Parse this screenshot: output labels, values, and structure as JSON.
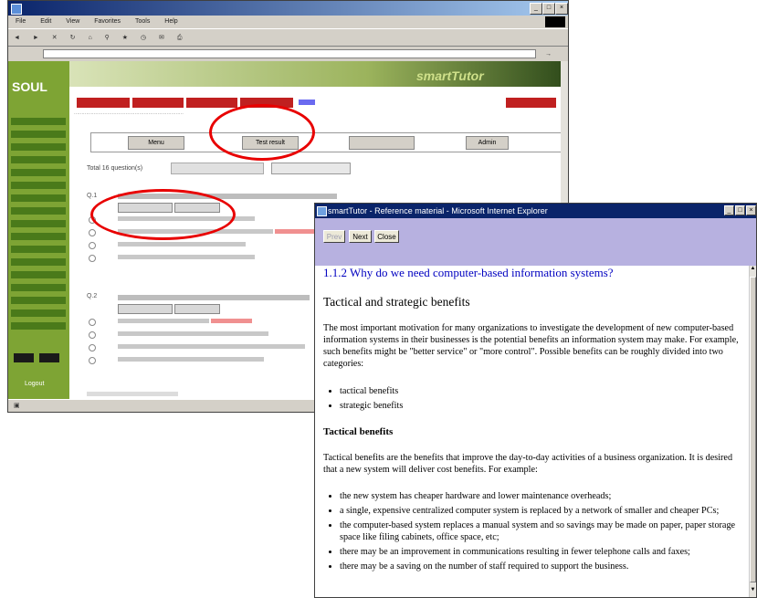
{
  "back_window": {
    "menu": [
      "File",
      "Edit",
      "View",
      "Favorites",
      "Tools",
      "Help"
    ],
    "logo": "SOUL",
    "banner_text": "smartTutor",
    "nav_buttons": [
      "Menu",
      "Test result",
      "",
      "Admin"
    ],
    "total_label": "Total 16 question(s)"
  },
  "popup": {
    "title": "smartTutor - Reference material - Microsoft Internet Explorer",
    "buttons": {
      "prev": "Prev",
      "next": "Next",
      "close": "Close"
    },
    "section_title": "1.1.2 Why do we need computer-based information systems?",
    "section_heading": "Tactical and strategic benefits",
    "intro_paragraph": "The most important motivation for many organizations to investigate the development of new computer-based information systems in their businesses is the potential benefits an information system may make. For example, such benefits might be \"better service\" or \"more control\". Possible benefits can be roughly divided into two categories:",
    "categories": [
      "tactical benefits",
      "strategic benefits"
    ],
    "tactical_heading": "Tactical benefits",
    "tactical_paragraph": "Tactical benefits are the benefits that improve the day-to-day activities of a business organization. It is desired that a new system will deliver cost benefits. For example:",
    "examples": [
      "the new system has cheaper hardware and lower maintenance overheads;",
      "a single, expensive centralized computer system is replaced by a network of smaller and cheaper PCs;",
      "the computer-based system replaces a manual system and so savings may be made on paper, paper storage space like filing cabinets, office space, etc;",
      "there may be an improvement in communications resulting in fewer telephone calls and faxes;",
      "there may be a saving on the number of staff required to support the business."
    ]
  }
}
